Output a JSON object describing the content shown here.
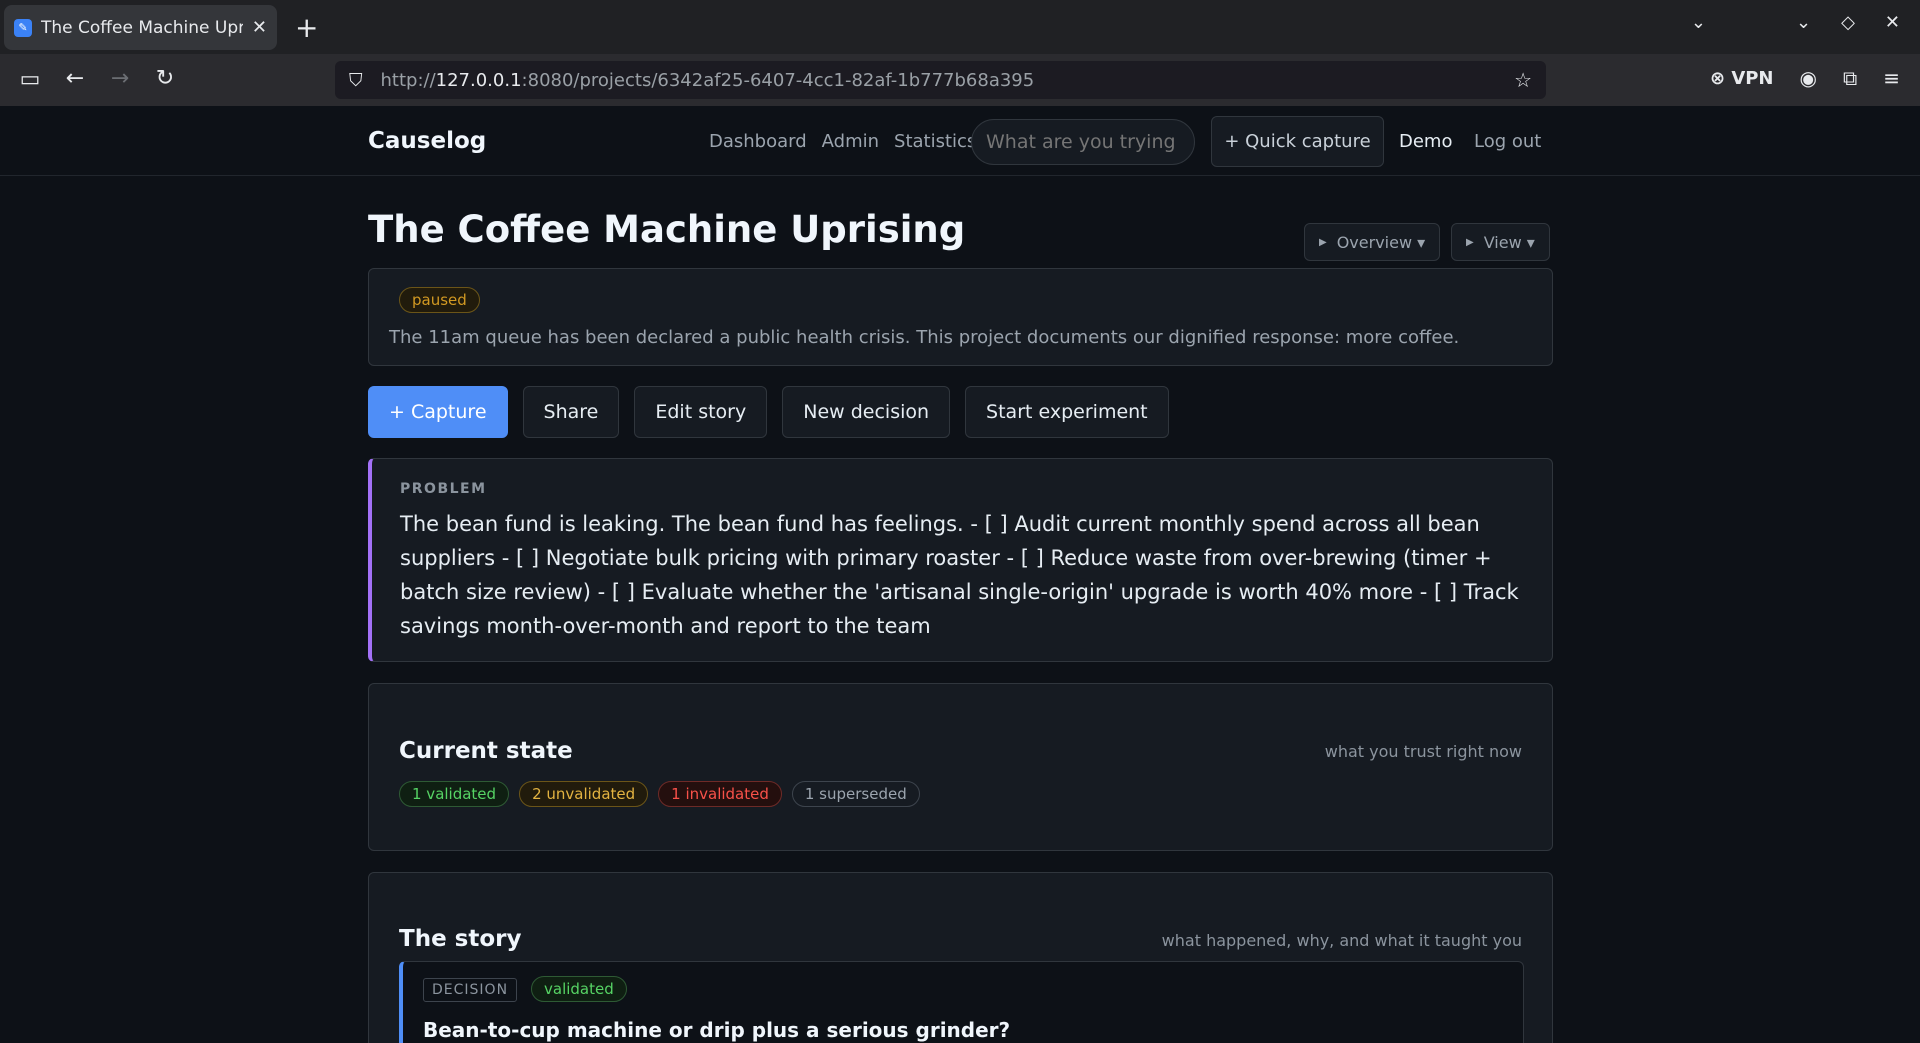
{
  "browser": {
    "tab_title": "The Coffee Machine Uprisi",
    "url_prefix": "http://",
    "url_host": "127.0.0.1",
    "url_rest": ":8080/projects/6342af25-6407-4cc1-82af-1b777b68a395",
    "vpn_label": "VPN"
  },
  "nav": {
    "brand": "Causelog",
    "links": [
      "Dashboard",
      "Admin",
      "Statistics"
    ],
    "search_placeholder": "What are you trying to",
    "quick_capture": "+ Quick capture",
    "user": "Demo",
    "logout": "Log out"
  },
  "project": {
    "title": "The Coffee Machine Uprising",
    "overview_menu": "Overview ▾",
    "view_menu": "View ▾",
    "status": "paused",
    "summary": "The 11am queue has been declared a public health crisis. This project documents our dignified response: more coffee."
  },
  "actions": {
    "capture": "+ Capture",
    "share": "Share",
    "edit_story": "Edit story",
    "new_decision": "New decision",
    "start_experiment": "Start experiment"
  },
  "problem": {
    "label": "PROBLEM",
    "text": "The bean fund is leaking. The bean fund has feelings. - [ ] Audit current monthly spend across all bean suppliers - [ ] Negotiate bulk pricing with primary roaster - [ ] Reduce waste from over-brewing (timer + batch size review) - [ ] Evaluate whether the 'artisanal single-origin' upgrade is worth 40% more - [ ] Track savings month-over-month and report to the team"
  },
  "current_state": {
    "title": "Current state",
    "hint": "what you trust right now",
    "validated": "1 validated",
    "unvalidated": "2 unvalidated",
    "invalidated": "1 invalidated",
    "superseded": "1 superseded"
  },
  "story": {
    "title": "The story",
    "hint": "what happened, why, and what it taught you",
    "items": [
      {
        "type": "DECISION",
        "status": "validated",
        "title": "Bean-to-cup machine or drip plus a serious grinder?"
      }
    ]
  }
}
